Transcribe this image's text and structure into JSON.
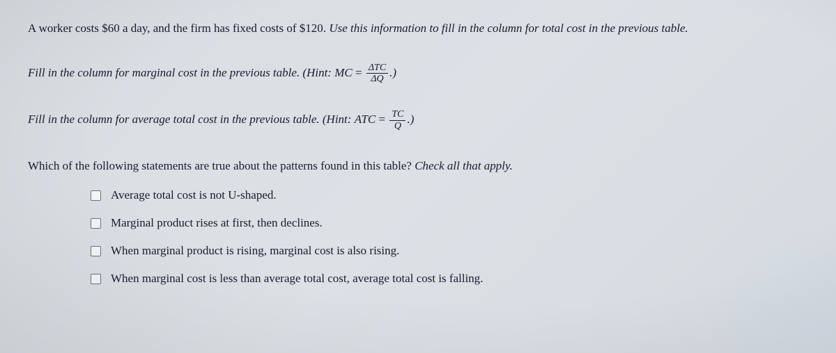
{
  "para1": {
    "normal": "A worker costs $60 a day, and the firm has fixed costs of $120. ",
    "italic": "Use this information to fill in the column for total cost in the previous table."
  },
  "para2": {
    "italic_lead": "Fill in the column for marginal cost in the previous table. ",
    "hint_open": "(Hint: ",
    "lhs": "MC",
    "eq": " = ",
    "num": "ΔTC",
    "den": "ΔQ",
    "hint_close": ".)"
  },
  "para3": {
    "italic_lead": "Fill in the column for average total cost in the previous table. ",
    "hint_open": "(Hint: ",
    "lhs": "ATC",
    "eq": " = ",
    "num": "TC",
    "den": "Q",
    "hint_close": ".)"
  },
  "question": {
    "main": "Which of the following statements are true about the patterns found in this table? ",
    "italic": "Check all that apply."
  },
  "options": [
    "Average total cost is not U-shaped.",
    "Marginal product rises at first, then declines.",
    "When marginal product is rising, marginal cost is also rising.",
    "When marginal cost is less than average total cost, average total cost is falling."
  ]
}
